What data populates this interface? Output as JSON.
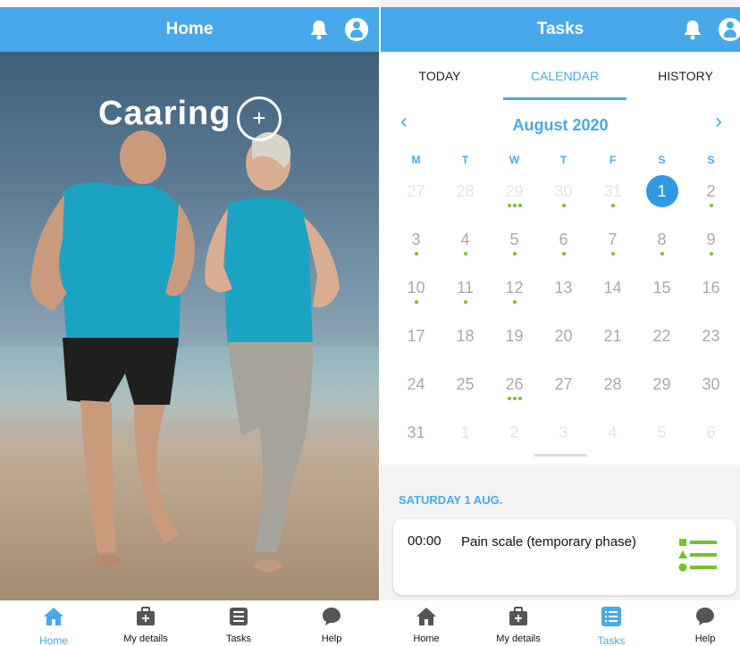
{
  "left_screen": {
    "header": {
      "title": "Home"
    },
    "logo_text": "Caaring",
    "bottom_nav": [
      {
        "label": "Home",
        "icon": "home-icon",
        "active": true
      },
      {
        "label": "My details",
        "icon": "medical-bag-icon",
        "active": false
      },
      {
        "label": "Tasks",
        "icon": "list-icon",
        "active": false
      },
      {
        "label": "Help",
        "icon": "chat-bubble-icon",
        "active": false
      }
    ]
  },
  "right_screen": {
    "header": {
      "title": "Tasks"
    },
    "tabs": [
      {
        "label": "TODAY",
        "active": false
      },
      {
        "label": "CALENDAR",
        "active": true
      },
      {
        "label": "HISTORY",
        "active": false
      }
    ],
    "calendar": {
      "month_label": "August 2020",
      "weekdays": [
        "M",
        "T",
        "W",
        "T",
        "F",
        "S",
        "S"
      ],
      "weeks": [
        [
          {
            "d": "27",
            "state": "dim",
            "dots": 0
          },
          {
            "d": "28",
            "state": "dim",
            "dots": 0
          },
          {
            "d": "29",
            "state": "dim",
            "dots": 3
          },
          {
            "d": "30",
            "state": "dim",
            "dots": 1
          },
          {
            "d": "31",
            "state": "dim",
            "dots": 1
          },
          {
            "d": "1",
            "state": "sel",
            "dots": 0
          },
          {
            "d": "2",
            "state": "norm",
            "dots": 1
          }
        ],
        [
          {
            "d": "3",
            "state": "norm",
            "dots": 1
          },
          {
            "d": "4",
            "state": "norm",
            "dots": 1
          },
          {
            "d": "5",
            "state": "norm",
            "dots": 1
          },
          {
            "d": "6",
            "state": "norm",
            "dots": 1
          },
          {
            "d": "7",
            "state": "norm",
            "dots": 1
          },
          {
            "d": "8",
            "state": "norm",
            "dots": 1
          },
          {
            "d": "9",
            "state": "norm",
            "dots": 1
          }
        ],
        [
          {
            "d": "10",
            "state": "norm",
            "dots": 1
          },
          {
            "d": "11",
            "state": "norm",
            "dots": 1
          },
          {
            "d": "12",
            "state": "norm",
            "dots": 1
          },
          {
            "d": "13",
            "state": "norm",
            "dots": 0
          },
          {
            "d": "14",
            "state": "norm",
            "dots": 0
          },
          {
            "d": "15",
            "state": "norm",
            "dots": 0
          },
          {
            "d": "16",
            "state": "norm",
            "dots": 0
          }
        ],
        [
          {
            "d": "17",
            "state": "norm",
            "dots": 0
          },
          {
            "d": "18",
            "state": "norm",
            "dots": 0
          },
          {
            "d": "19",
            "state": "norm",
            "dots": 0
          },
          {
            "d": "20",
            "state": "norm",
            "dots": 0
          },
          {
            "d": "21",
            "state": "norm",
            "dots": 0
          },
          {
            "d": "22",
            "state": "norm",
            "dots": 0
          },
          {
            "d": "23",
            "state": "norm",
            "dots": 0
          }
        ],
        [
          {
            "d": "24",
            "state": "norm",
            "dots": 0
          },
          {
            "d": "25",
            "state": "norm",
            "dots": 0
          },
          {
            "d": "26",
            "state": "norm",
            "dots": 3
          },
          {
            "d": "27",
            "state": "norm",
            "dots": 0
          },
          {
            "d": "28",
            "state": "norm",
            "dots": 0
          },
          {
            "d": "29",
            "state": "norm",
            "dots": 0
          },
          {
            "d": "30",
            "state": "norm",
            "dots": 0
          }
        ],
        [
          {
            "d": "31",
            "state": "norm",
            "dots": 0
          },
          {
            "d": "1",
            "state": "dim",
            "dots": 0
          },
          {
            "d": "2",
            "state": "dim",
            "dots": 0
          },
          {
            "d": "3",
            "state": "dim",
            "dots": 0
          },
          {
            "d": "4",
            "state": "dim",
            "dots": 0
          },
          {
            "d": "5",
            "state": "dim",
            "dots": 0
          },
          {
            "d": "6",
            "state": "dim",
            "dots": 0
          }
        ]
      ]
    },
    "selected_day_title": "SATURDAY 1 AUG.",
    "task": {
      "time": "00:00",
      "name": "Pain scale (temporary phase)"
    },
    "bottom_nav": [
      {
        "label": "Home",
        "icon": "home-icon",
        "active": false
      },
      {
        "label": "My details",
        "icon": "medical-bag-icon",
        "active": false
      },
      {
        "label": "Tasks",
        "icon": "list-icon",
        "active": true
      },
      {
        "label": "Help",
        "icon": "chat-bubble-icon",
        "active": false
      }
    ]
  },
  "colors": {
    "primary": "#48a9ea",
    "selected_day": "#2f9ae0",
    "dot": "#76c22b",
    "task_icon": "#76c22b"
  }
}
